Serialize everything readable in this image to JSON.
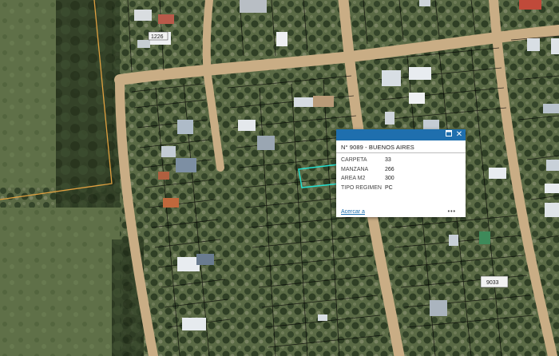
{
  "map": {
    "house_labels": [
      "1226",
      "9033"
    ]
  },
  "popup": {
    "title": "N° 9089 - BUENOS AIRES",
    "attributes": [
      {
        "key": "CARPETA",
        "value": "33"
      },
      {
        "key": "MANZANA",
        "value": "266"
      },
      {
        "key": "AREA M2",
        "value": "300"
      },
      {
        "key": "TIPO REGIMEN",
        "value": "PC"
      }
    ],
    "zoom_label": "Acercar a",
    "more_label": "•••",
    "maximize_icon": "maximize-icon",
    "close_icon": "close-icon"
  },
  "colors": {
    "header": "#1f6fae",
    "parcel_lines": "#000000",
    "selected_parcel": "#26e0d0",
    "boundary": "#e0a040"
  }
}
